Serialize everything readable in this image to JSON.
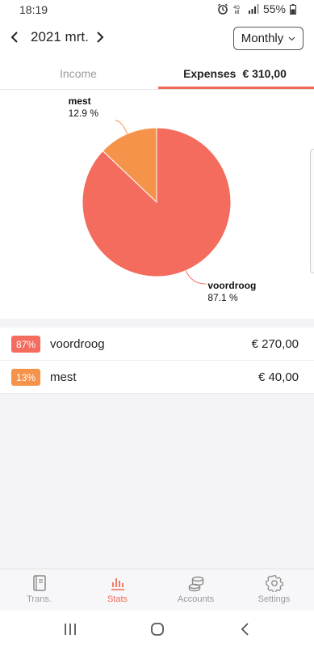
{
  "status": {
    "time": "18:19",
    "network": "4G",
    "battery": "55%"
  },
  "header": {
    "month": "2021 mrt.",
    "period": "Monthly"
  },
  "tabs": {
    "income": "Income",
    "expenses_label": "Expenses",
    "expenses_total": "€ 310,00"
  },
  "colors": {
    "accent": "#ef6b57",
    "voordroog": "#f36c5e",
    "mest": "#f5934a"
  },
  "chart_data": {
    "type": "pie",
    "slices": [
      {
        "label": "voordroog",
        "value": 87.1,
        "percent_label": "87.1 %",
        "color": "#f36c5e"
      },
      {
        "label": "mest",
        "value": 12.9,
        "percent_label": "12.9 %",
        "color": "#f5934a"
      }
    ]
  },
  "list": [
    {
      "badge": "87%",
      "name": "voordroog",
      "amount": "€ 270,00",
      "color": "#f36c5e"
    },
    {
      "badge": "13%",
      "name": "mest",
      "amount": "€ 40,00",
      "color": "#f5934a"
    }
  ],
  "bottom_nav": [
    {
      "label": "Trans.",
      "icon": "book-icon",
      "active": false
    },
    {
      "label": "Stats",
      "icon": "bar-chart-icon",
      "active": true
    },
    {
      "label": "Accounts",
      "icon": "coins-icon",
      "active": false
    },
    {
      "label": "Settings",
      "icon": "gear-icon",
      "active": false
    }
  ],
  "system_nav": [
    "recent-apps-icon",
    "home-icon",
    "back-icon"
  ]
}
